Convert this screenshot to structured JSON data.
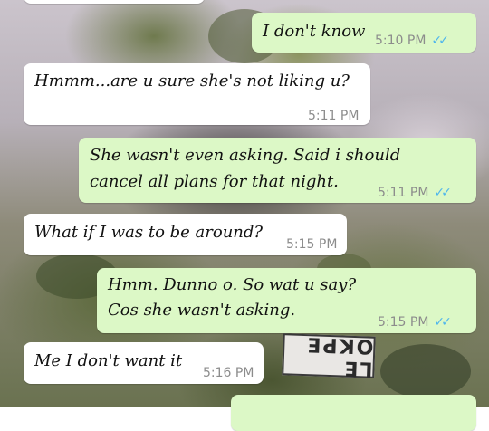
{
  "wallpaper": {
    "label_text": "LE OKPE"
  },
  "messages": [
    {
      "direction": "out",
      "text": "I don't know",
      "time": "5:10 PM",
      "status": "read"
    },
    {
      "direction": "in",
      "text": "Hmmm...are u sure she's not liking u?",
      "time": "5:11 PM"
    },
    {
      "direction": "out",
      "lines": [
        "She wasn't even asking. Said i should",
        "cancel all plans for that night."
      ],
      "time": "5:11 PM",
      "status": "read"
    },
    {
      "direction": "in",
      "text": "What if I was to be around?",
      "time": "5:15 PM"
    },
    {
      "direction": "out",
      "lines": [
        "Hmm. Dunno o. So wat u say?",
        "Cos she wasn't asking."
      ],
      "time": "5:15 PM",
      "status": "read"
    },
    {
      "direction": "in",
      "text": "Me I don't want it",
      "time": "5:16 PM"
    }
  ],
  "icons": {
    "read_receipt": "double-check-icon"
  },
  "colors": {
    "incoming": "#ffffff",
    "outgoing": "#dcf8c6",
    "read_tick": "#4fb6ec",
    "timestamp": "#8c8c8c"
  }
}
